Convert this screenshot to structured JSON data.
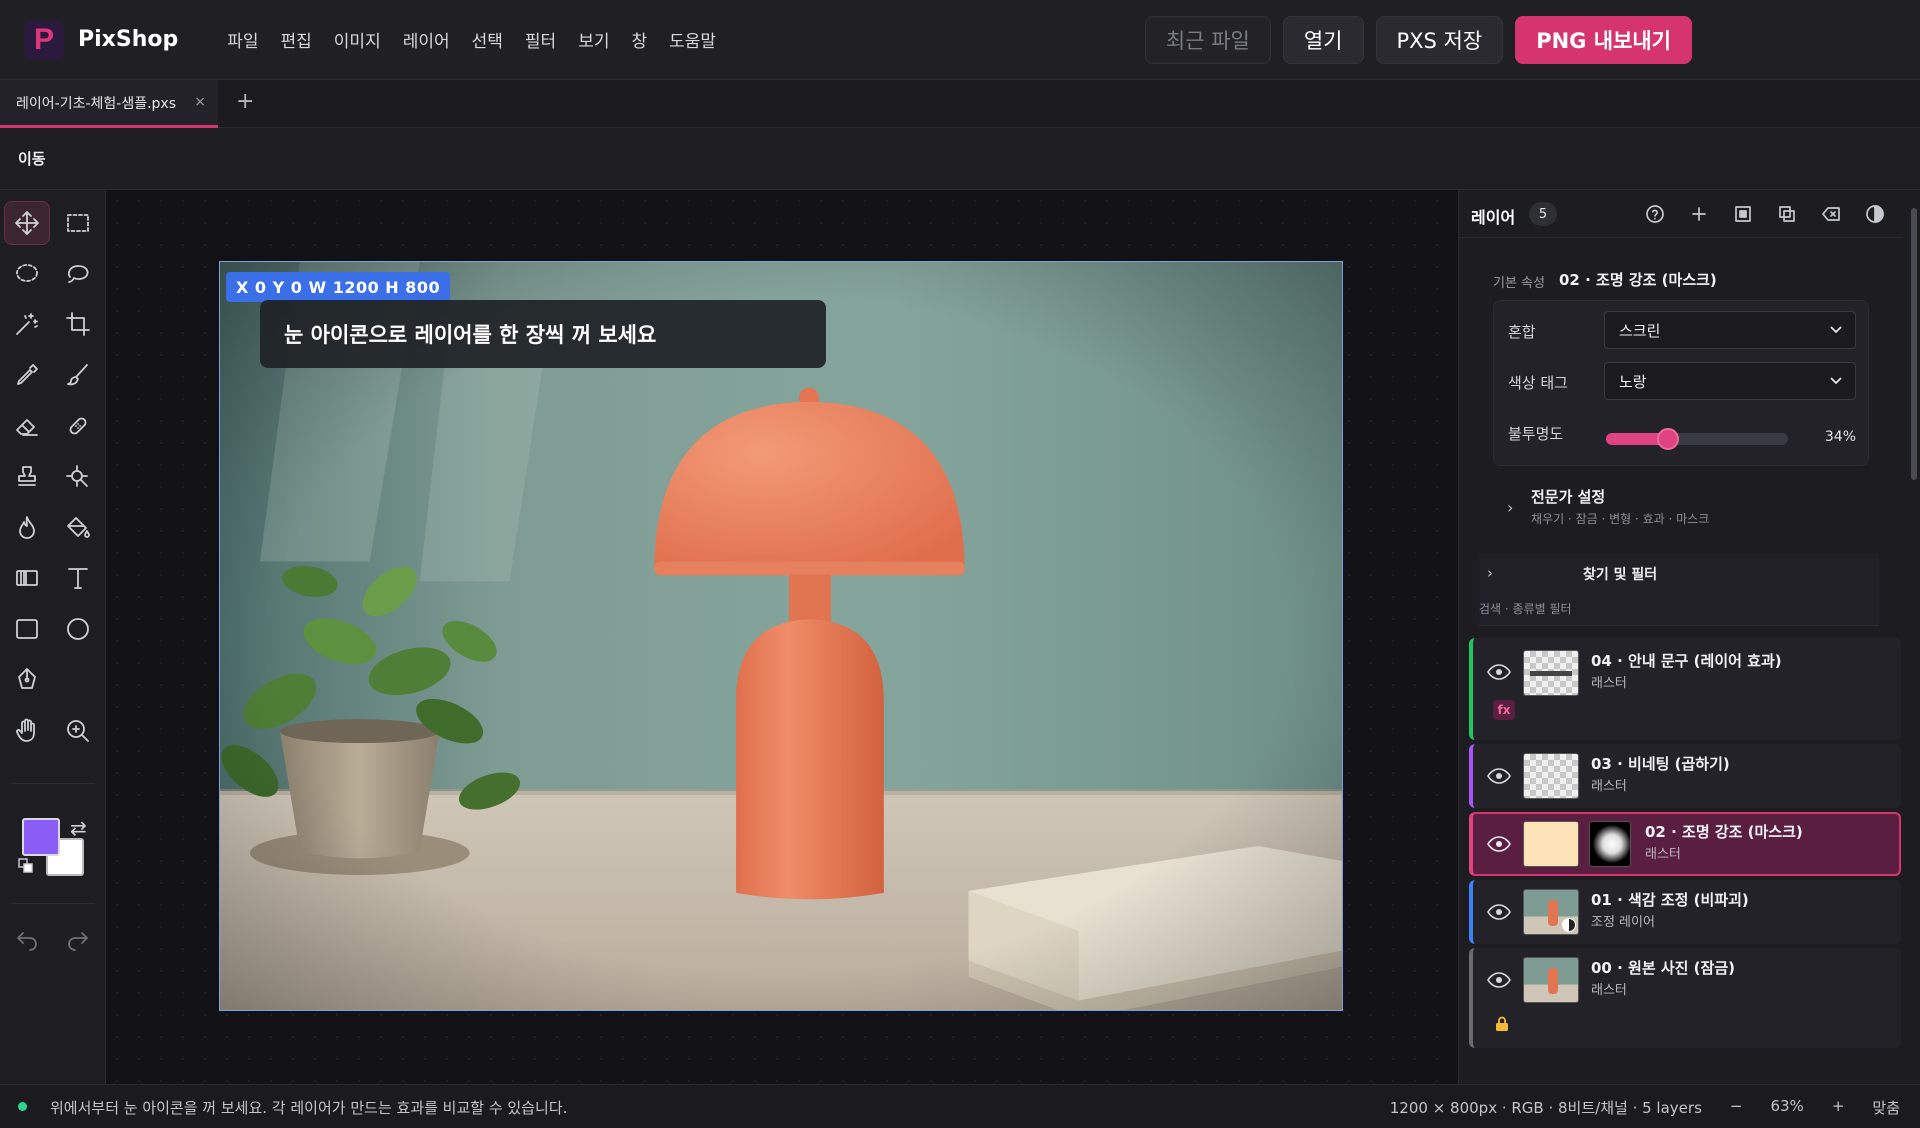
{
  "app": {
    "name": "PixShop",
    "menu": [
      "파일",
      "편집",
      "이미지",
      "레이어",
      "선택",
      "필터",
      "보기",
      "창",
      "도움말"
    ],
    "actions": {
      "recent": "최근 파일",
      "open": "열기",
      "save_pxs": "PXS 저장",
      "export_png": "PNG 내보내기"
    }
  },
  "tabs": {
    "document": "레이어-기초-체험-샘플.pxs",
    "close": "×",
    "add": "+"
  },
  "options": {
    "tool_name": "이동"
  },
  "toolbar": {
    "tools": [
      "move",
      "marquee",
      "ellipse-select",
      "lasso",
      "magic-wand",
      "crop",
      "eyedropper",
      "brush",
      "eraser",
      "healing",
      "stamp",
      "spot-select",
      "burn",
      "paint-bucket",
      "gradient",
      "text",
      "rectangle",
      "ellipse",
      "pen",
      "hand",
      "zoom"
    ],
    "fg_color": "#8b5cf6",
    "bg_color": "#ffffff"
  },
  "canvas": {
    "dims_badge": "X 0   Y 0   W 1200   H 800",
    "hint": "눈 아이콘으로 레이어를 한 장씩 꺼 보세요"
  },
  "panel": {
    "title": "레이어",
    "count": "5",
    "props_label": "기본 속성",
    "props_layer": "02 · 조명 강조 (마스크)",
    "blend_label": "혼합",
    "blend_value": "스크린",
    "tag_label": "색상 태그",
    "tag_value": "노랑",
    "opacity_label": "불투명도",
    "opacity_value": "34%",
    "opacity": 34,
    "advanced_title": "전문가 설정",
    "advanced_sub": "채우기 · 잠금 · 변형 · 효과 · 마스크",
    "find_title": "찾기 및 필터",
    "find_sub": "검색 · 종류별 필터",
    "layers": [
      {
        "name": "04 · 안내 문구 (레이어 효과)",
        "kind": "래스터",
        "color": "#22c55e",
        "fx": "fx"
      },
      {
        "name": "03 · 비네팅 (곱하기)",
        "kind": "래스터",
        "color": "#a855f7"
      },
      {
        "name": "02 · 조명 강조 (마스크)",
        "kind": "래스터",
        "color": "#e04480"
      },
      {
        "name": "01 · 색감 조정 (비파괴)",
        "kind": "조정 레이어",
        "color": "#3b82f6"
      },
      {
        "name": "00 · 원본 사진 (잠금)",
        "kind": "래스터",
        "color": "#6b6b73"
      }
    ]
  },
  "status": {
    "message": "위에서부터 눈 아이콘을 꺼 보세요. 각 레이어가 만드는 효과를 비교할 수 있습니다.",
    "doc_info": "1200 × 800px · RGB · 8비트/채널 · 5 layers",
    "zoom_out": "−",
    "zoom": "63%",
    "zoom_in": "+",
    "fit": "맞춤"
  },
  "colors": {
    "accent": "#d5356c",
    "selection": "#3b6fe8"
  }
}
